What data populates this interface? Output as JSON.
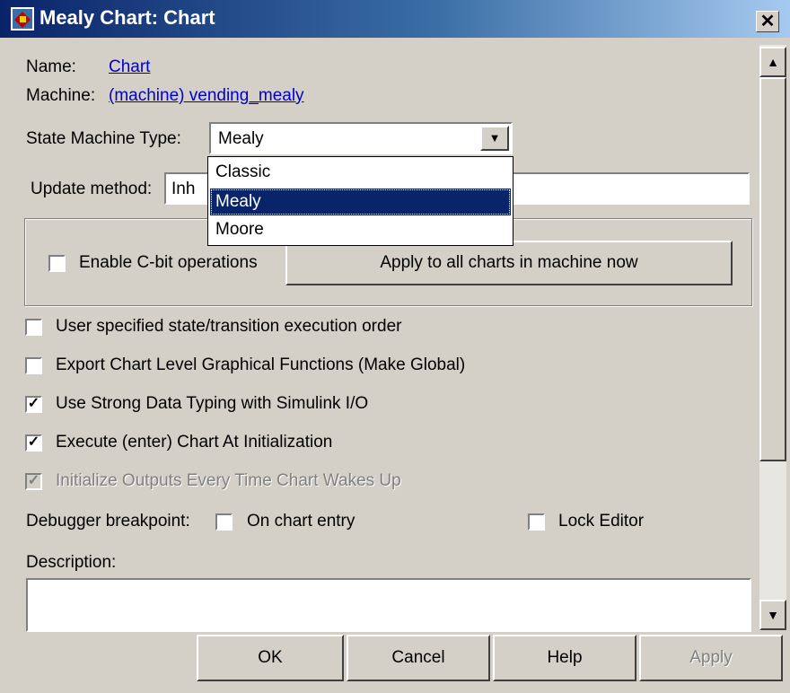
{
  "window": {
    "title": "Mealy Chart: Chart",
    "close_glyph": "✕"
  },
  "name_label": "Name:",
  "name_link": "Chart",
  "machine_label": "Machine:",
  "machine_link": "(machine) vending_mealy",
  "state_machine_type": {
    "label": "State Machine Type:",
    "value": "Mealy",
    "options": [
      "Classic",
      "Mealy",
      "Moore"
    ],
    "highlighted": "Mealy"
  },
  "update_method": {
    "label": "Update method:",
    "value_visible": "Inh"
  },
  "cbit": {
    "label": "Enable C-bit operations",
    "checked": false
  },
  "apply_all_button": "Apply to all charts in machine now",
  "options": [
    {
      "label": "User specified state/transition execution order",
      "checked": false,
      "enabled": true
    },
    {
      "label": "Export Chart Level Graphical Functions (Make Global)",
      "checked": false,
      "enabled": true
    },
    {
      "label": "Use Strong Data Typing with Simulink I/O",
      "checked": true,
      "enabled": true
    },
    {
      "label": "Execute (enter) Chart At Initialization",
      "checked": true,
      "enabled": true
    },
    {
      "label": "Initialize Outputs Every Time Chart Wakes Up",
      "checked": true,
      "enabled": false
    }
  ],
  "debugger": {
    "label": "Debugger breakpoint:",
    "entry_label": "On chart entry",
    "entry_checked": false
  },
  "lock_editor": {
    "label": "Lock Editor",
    "checked": false
  },
  "description": {
    "label": "Description:",
    "value": ""
  },
  "buttons": {
    "ok": "OK",
    "cancel": "Cancel",
    "help": "Help",
    "apply": "Apply"
  },
  "glyphs": {
    "check": "✓",
    "dropdown": "▼",
    "scroll_up": "▲",
    "scroll_down": "▼"
  },
  "colors": {
    "title_start": "#0a246a",
    "title_end": "#a6caf0",
    "selection": "#0a246a",
    "link": "#0000cc",
    "face": "#d4d0c8"
  }
}
